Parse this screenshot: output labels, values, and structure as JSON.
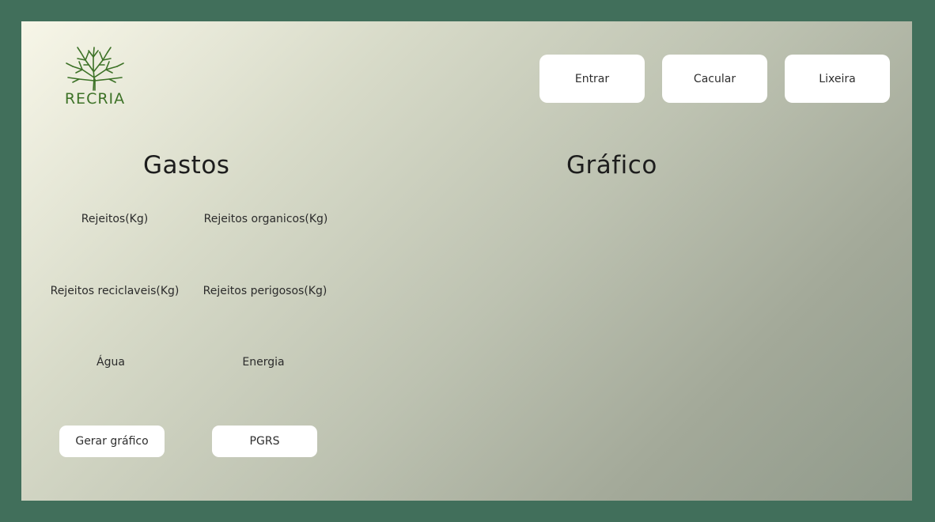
{
  "brand": {
    "name": "RECRIA",
    "color": "#3d7227"
  },
  "nav": {
    "entrar": "Entrar",
    "calcular": "Cacular",
    "lixeira": "Lixeira"
  },
  "gastos": {
    "title": "Gastos",
    "fields": {
      "rejeitos": "Rejeitos(Kg)",
      "organicos": "Rejeitos organicos(Kg)",
      "reciclaveis": "Rejeitos reciclaveis(Kg)",
      "perigosos": "Rejeitos perigosos(Kg)",
      "agua": "Água",
      "energia": "Energia"
    },
    "actions": {
      "gerar": "Gerar gráfico",
      "pgrs": "PGRS"
    }
  },
  "grafico": {
    "title": "Gráfico"
  },
  "colors": {
    "outer_background": "#416f5b",
    "button_background": "#ffffff",
    "tree": "#3d7227"
  }
}
